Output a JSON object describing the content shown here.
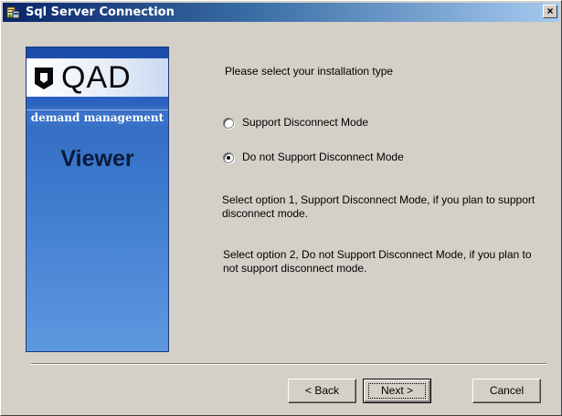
{
  "window": {
    "title": "Sql Server Connection",
    "close_label": "×"
  },
  "banner": {
    "logo_text": "QAD",
    "subtitle": "demand management",
    "product": "Viewer"
  },
  "content": {
    "prompt": "Please select your installation type",
    "options": [
      {
        "label": "Support Disconnect Mode",
        "selected": false
      },
      {
        "label": "Do not Support Disconnect Mode",
        "selected": true
      }
    ],
    "desc1": "Select option 1, Support Disconnect Mode, if you plan to support disconnect mode.",
    "desc2": "Select option 2, Do not Support Disconnect Mode, if you plan to not support disconnect mode."
  },
  "buttons": {
    "back": "< Back",
    "next": "Next >",
    "cancel": "Cancel"
  },
  "colors": {
    "titlebar_start": "#0a246a",
    "titlebar_end": "#a6caf0",
    "dialog_bg": "#d4d0c8",
    "banner_blue": "#3c79cc"
  }
}
